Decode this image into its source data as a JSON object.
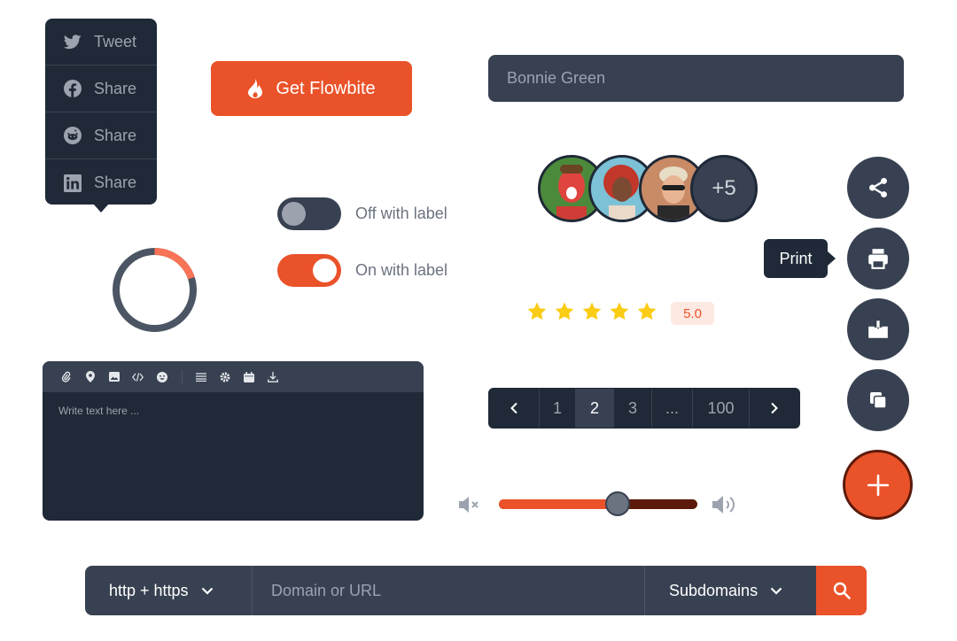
{
  "share_menu": {
    "items": [
      {
        "label": "Tweet",
        "icon": "twitter-icon"
      },
      {
        "label": "Share",
        "icon": "facebook-icon"
      },
      {
        "label": "Share",
        "icon": "reddit-icon"
      },
      {
        "label": "Share",
        "icon": "linkedin-icon"
      }
    ]
  },
  "cta_button": {
    "label": "Get Flowbite",
    "icon": "fire-icon"
  },
  "name_field": {
    "value": "Bonnie Green"
  },
  "toggles": [
    {
      "label": "Off with label",
      "checked": false
    },
    {
      "label": "On with label",
      "checked": true
    }
  ],
  "avatars": {
    "more_label": "+5"
  },
  "rating": {
    "stars": 5,
    "max": 5,
    "value_label": "5.0"
  },
  "speed_dial": {
    "tooltip": "Print",
    "actions": [
      "share-icon",
      "printer-icon",
      "download-icon",
      "copy-icon"
    ],
    "main_icon": "plus-icon"
  },
  "progress_ring": {
    "percent": 0.2
  },
  "editor": {
    "placeholder": "Write text here ..."
  },
  "pagination": {
    "pages": [
      "1",
      "2",
      "3",
      "...",
      "100"
    ],
    "active": "2"
  },
  "volume": {
    "level": 0.6
  },
  "search_bar": {
    "protocol_label": "http + https",
    "placeholder": "Domain or URL",
    "subdomains_label": "Subdomains"
  },
  "colors": {
    "accent": "#ea5229",
    "dark": "#1f2937",
    "slate": "#374151",
    "star": "#facc15"
  }
}
